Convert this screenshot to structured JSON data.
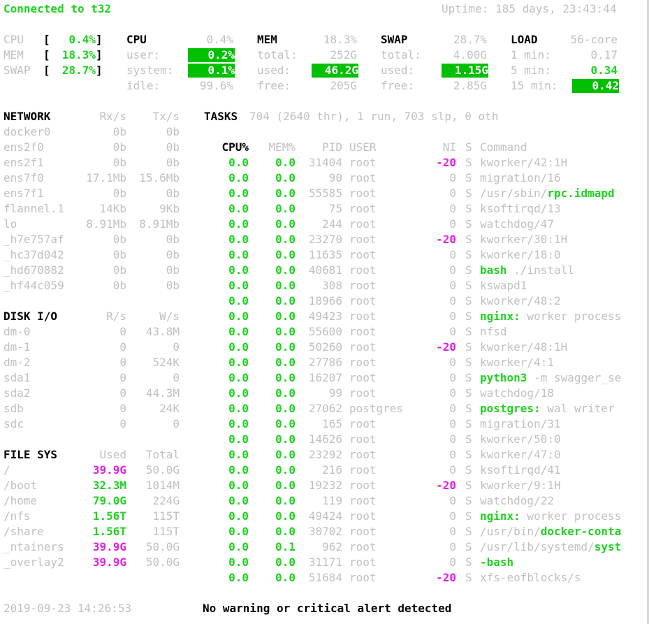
{
  "header": {
    "connected": "Connected to t32",
    "uptime": "Uptime: 185 days, 23:43:44"
  },
  "quicklook": [
    {
      "label": "CPU",
      "value": "0.4%"
    },
    {
      "label": "MEM",
      "value": "18.3%"
    },
    {
      "label": "SWAP",
      "value": "28.7%"
    }
  ],
  "cpu": {
    "title": "CPU",
    "pct": "0.4%",
    "rows": [
      {
        "label": "user:",
        "value": "0.2%"
      },
      {
        "label": "system:",
        "value": "0.1%"
      },
      {
        "label": "idle:",
        "value": "99.6%"
      }
    ]
  },
  "mem": {
    "title": "MEM",
    "pct": "18.3%",
    "rows": [
      {
        "label": "total:",
        "value": "252G"
      },
      {
        "label": "used:",
        "value": "46.2G"
      },
      {
        "label": "free:",
        "value": "205G"
      }
    ]
  },
  "swap": {
    "title": "SWAP",
    "pct": "28.7%",
    "rows": [
      {
        "label": "total:",
        "value": "4.00G"
      },
      {
        "label": "used:",
        "value": "1.15G"
      },
      {
        "label": "free:",
        "value": "2.85G"
      }
    ]
  },
  "load": {
    "title": "LOAD",
    "cores": "56-core",
    "rows": [
      {
        "label": "1 min:",
        "value": "0.17"
      },
      {
        "label": "5 min:",
        "value": "0.34"
      },
      {
        "label": "15 min:",
        "value": "0.42"
      }
    ]
  },
  "network": {
    "title": "NETWORK",
    "rx": "Rx/s",
    "tx": "Tx/s",
    "rows": [
      {
        "name": "docker0",
        "rx": "0b",
        "tx": "0b"
      },
      {
        "name": "ens2f0",
        "rx": "0b",
        "tx": "0b"
      },
      {
        "name": "ens2f1",
        "rx": "0b",
        "tx": "0b"
      },
      {
        "name": "ens7f0",
        "rx": "17.1Mb",
        "tx": "15.6Mb"
      },
      {
        "name": "ens7f1",
        "rx": "0b",
        "tx": "0b"
      },
      {
        "name": "flannel.1",
        "rx": "14Kb",
        "tx": "9Kb"
      },
      {
        "name": "lo",
        "rx": "8.91Mb",
        "tx": "8.91Mb"
      },
      {
        "name": "_h7e757af",
        "rx": "0b",
        "tx": "0b"
      },
      {
        "name": "_hc37d042",
        "rx": "0b",
        "tx": "0b"
      },
      {
        "name": "_hd670882",
        "rx": "0b",
        "tx": "0b"
      },
      {
        "name": "_hf44c059",
        "rx": "0b",
        "tx": "0b"
      }
    ]
  },
  "disk": {
    "title": "DISK I/O",
    "r": "R/s",
    "w": "W/s",
    "rows": [
      {
        "name": "dm-0",
        "r": "0",
        "w": "43.8M"
      },
      {
        "name": "dm-1",
        "r": "0",
        "w": "0"
      },
      {
        "name": "dm-2",
        "r": "0",
        "w": "524K"
      },
      {
        "name": "sda1",
        "r": "0",
        "w": "0"
      },
      {
        "name": "sda2",
        "r": "0",
        "w": "44.3M"
      },
      {
        "name": "sdb",
        "r": "0",
        "w": "24K"
      },
      {
        "name": "sdc",
        "r": "0",
        "w": "0"
      }
    ]
  },
  "fs": {
    "title": "FILE SYS",
    "used": "Used",
    "total": "Total",
    "rows": [
      {
        "name": "/",
        "used": "39.9G",
        "total": "50.0G",
        "level": "careful"
      },
      {
        "name": "/boot",
        "used": "32.3M",
        "total": "1014M",
        "level": "ok"
      },
      {
        "name": "/home",
        "used": "79.0G",
        "total": "224G",
        "level": "ok"
      },
      {
        "name": "/nfs",
        "used": "1.56T",
        "total": "115T",
        "level": "ok"
      },
      {
        "name": "/share",
        "used": "1.56T",
        "total": "115T",
        "level": "ok"
      },
      {
        "name": "_ntainers",
        "used": "39.9G",
        "total": "50.0G",
        "level": "careful"
      },
      {
        "name": "_overlay2",
        "used": "39.9G",
        "total": "50.0G",
        "level": "careful"
      }
    ]
  },
  "tasks": {
    "title": "TASKS",
    "summary": "704 (2640 thr), 1 run, 703 slp, 0 oth"
  },
  "proc_headers": {
    "cpu": "CPU%",
    "mem": "MEM%",
    "pid": "PID",
    "user": "USER",
    "ni": "NI",
    "s": "S",
    "cmd": "Command"
  },
  "processes": [
    {
      "cpu": "0.0",
      "mem": "0.0",
      "pid": "31404",
      "user": "root",
      "ni": "-20",
      "s": "S",
      "bin": "",
      "rest": "kworker/42:1H"
    },
    {
      "cpu": "0.0",
      "mem": "0.0",
      "pid": "90",
      "user": "root",
      "ni": "0",
      "s": "S",
      "bin": "",
      "rest": "migration/16"
    },
    {
      "cpu": "0.0",
      "mem": "0.0",
      "pid": "55585",
      "user": "root",
      "ni": "0",
      "s": "S",
      "path": "/usr/sbin/",
      "bin": "rpc.idmapd",
      "rest": ""
    },
    {
      "cpu": "0.0",
      "mem": "0.0",
      "pid": "75",
      "user": "root",
      "ni": "0",
      "s": "S",
      "bin": "",
      "rest": "ksoftirqd/13"
    },
    {
      "cpu": "0.0",
      "mem": "0.0",
      "pid": "244",
      "user": "root",
      "ni": "0",
      "s": "S",
      "bin": "",
      "rest": "watchdog/47"
    },
    {
      "cpu": "0.0",
      "mem": "0.0",
      "pid": "23270",
      "user": "root",
      "ni": "-20",
      "s": "S",
      "bin": "",
      "rest": "kworker/30:1H"
    },
    {
      "cpu": "0.0",
      "mem": "0.0",
      "pid": "11635",
      "user": "root",
      "ni": "0",
      "s": "S",
      "bin": "",
      "rest": "kworker/18:0"
    },
    {
      "cpu": "0.0",
      "mem": "0.0",
      "pid": "40681",
      "user": "root",
      "ni": "0",
      "s": "S",
      "bin": "bash",
      "rest": " ./install"
    },
    {
      "cpu": "0.0",
      "mem": "0.0",
      "pid": "308",
      "user": "root",
      "ni": "0",
      "s": "S",
      "bin": "",
      "rest": "kswapd1"
    },
    {
      "cpu": "0.0",
      "mem": "0.0",
      "pid": "18966",
      "user": "root",
      "ni": "0",
      "s": "S",
      "bin": "",
      "rest": "kworker/48:2"
    },
    {
      "cpu": "0.0",
      "mem": "0.0",
      "pid": "49423",
      "user": "root",
      "ni": "0",
      "s": "S",
      "bin": "nginx:",
      "rest": " worker process"
    },
    {
      "cpu": "0.0",
      "mem": "0.0",
      "pid": "55600",
      "user": "root",
      "ni": "0",
      "s": "S",
      "bin": "",
      "rest": "nfsd"
    },
    {
      "cpu": "0.0",
      "mem": "0.0",
      "pid": "50260",
      "user": "root",
      "ni": "-20",
      "s": "S",
      "bin": "",
      "rest": "kworker/48:1H"
    },
    {
      "cpu": "0.0",
      "mem": "0.0",
      "pid": "27786",
      "user": "root",
      "ni": "0",
      "s": "S",
      "bin": "",
      "rest": "kworker/4:1"
    },
    {
      "cpu": "0.0",
      "mem": "0.0",
      "pid": "16207",
      "user": "root",
      "ni": "0",
      "s": "S",
      "bin": "python3",
      "rest": " -m swagger_se"
    },
    {
      "cpu": "0.0",
      "mem": "0.0",
      "pid": "99",
      "user": "root",
      "ni": "0",
      "s": "S",
      "bin": "",
      "rest": "watchdog/18"
    },
    {
      "cpu": "0.0",
      "mem": "0.0",
      "pid": "27062",
      "user": "postgres",
      "ni": "0",
      "s": "S",
      "bin": "postgres:",
      "rest": " wal writer"
    },
    {
      "cpu": "0.0",
      "mem": "0.0",
      "pid": "165",
      "user": "root",
      "ni": "0",
      "s": "S",
      "bin": "",
      "rest": "migration/31"
    },
    {
      "cpu": "0.0",
      "mem": "0.0",
      "pid": "14626",
      "user": "root",
      "ni": "0",
      "s": "S",
      "bin": "",
      "rest": "kworker/50:0"
    },
    {
      "cpu": "0.0",
      "mem": "0.0",
      "pid": "23292",
      "user": "root",
      "ni": "0",
      "s": "S",
      "bin": "",
      "rest": "kworker/47:0"
    },
    {
      "cpu": "0.0",
      "mem": "0.0",
      "pid": "216",
      "user": "root",
      "ni": "0",
      "s": "S",
      "bin": "",
      "rest": "ksoftirqd/41"
    },
    {
      "cpu": "0.0",
      "mem": "0.0",
      "pid": "19232",
      "user": "root",
      "ni": "-20",
      "s": "S",
      "bin": "",
      "rest": "kworker/9:1H"
    },
    {
      "cpu": "0.0",
      "mem": "0.0",
      "pid": "119",
      "user": "root",
      "ni": "0",
      "s": "S",
      "bin": "",
      "rest": "watchdog/22"
    },
    {
      "cpu": "0.0",
      "mem": "0.0",
      "pid": "49424",
      "user": "root",
      "ni": "0",
      "s": "S",
      "bin": "nginx:",
      "rest": " worker process"
    },
    {
      "cpu": "0.0",
      "mem": "0.0",
      "pid": "38702",
      "user": "root",
      "ni": "0",
      "s": "S",
      "path": "/usr/bin/",
      "bin": "docker-conta",
      "rest": ""
    },
    {
      "cpu": "0.0",
      "mem": "0.1",
      "pid": "962",
      "user": "root",
      "ni": "0",
      "s": "S",
      "path": "/usr/lib/systemd/",
      "bin": "syst",
      "rest": ""
    },
    {
      "cpu": "0.0",
      "mem": "0.0",
      "pid": "31171",
      "user": "root",
      "ni": "0",
      "s": "S",
      "bin": "-bash",
      "rest": ""
    },
    {
      "cpu": "0.0",
      "mem": "0.0",
      "pid": "51684",
      "user": "root",
      "ni": "-20",
      "s": "S",
      "bin": "",
      "rest": "xfs-eofblocks/s"
    }
  ],
  "footer": {
    "datetime": "2019-09-23 14:26:53",
    "alert": "No warning or critical alert detected"
  },
  "colors": {
    "ok": "#1fd31f",
    "careful": "#e020e0",
    "highlight_bg": "#00c000",
    "dim": "#c0c0c0"
  }
}
